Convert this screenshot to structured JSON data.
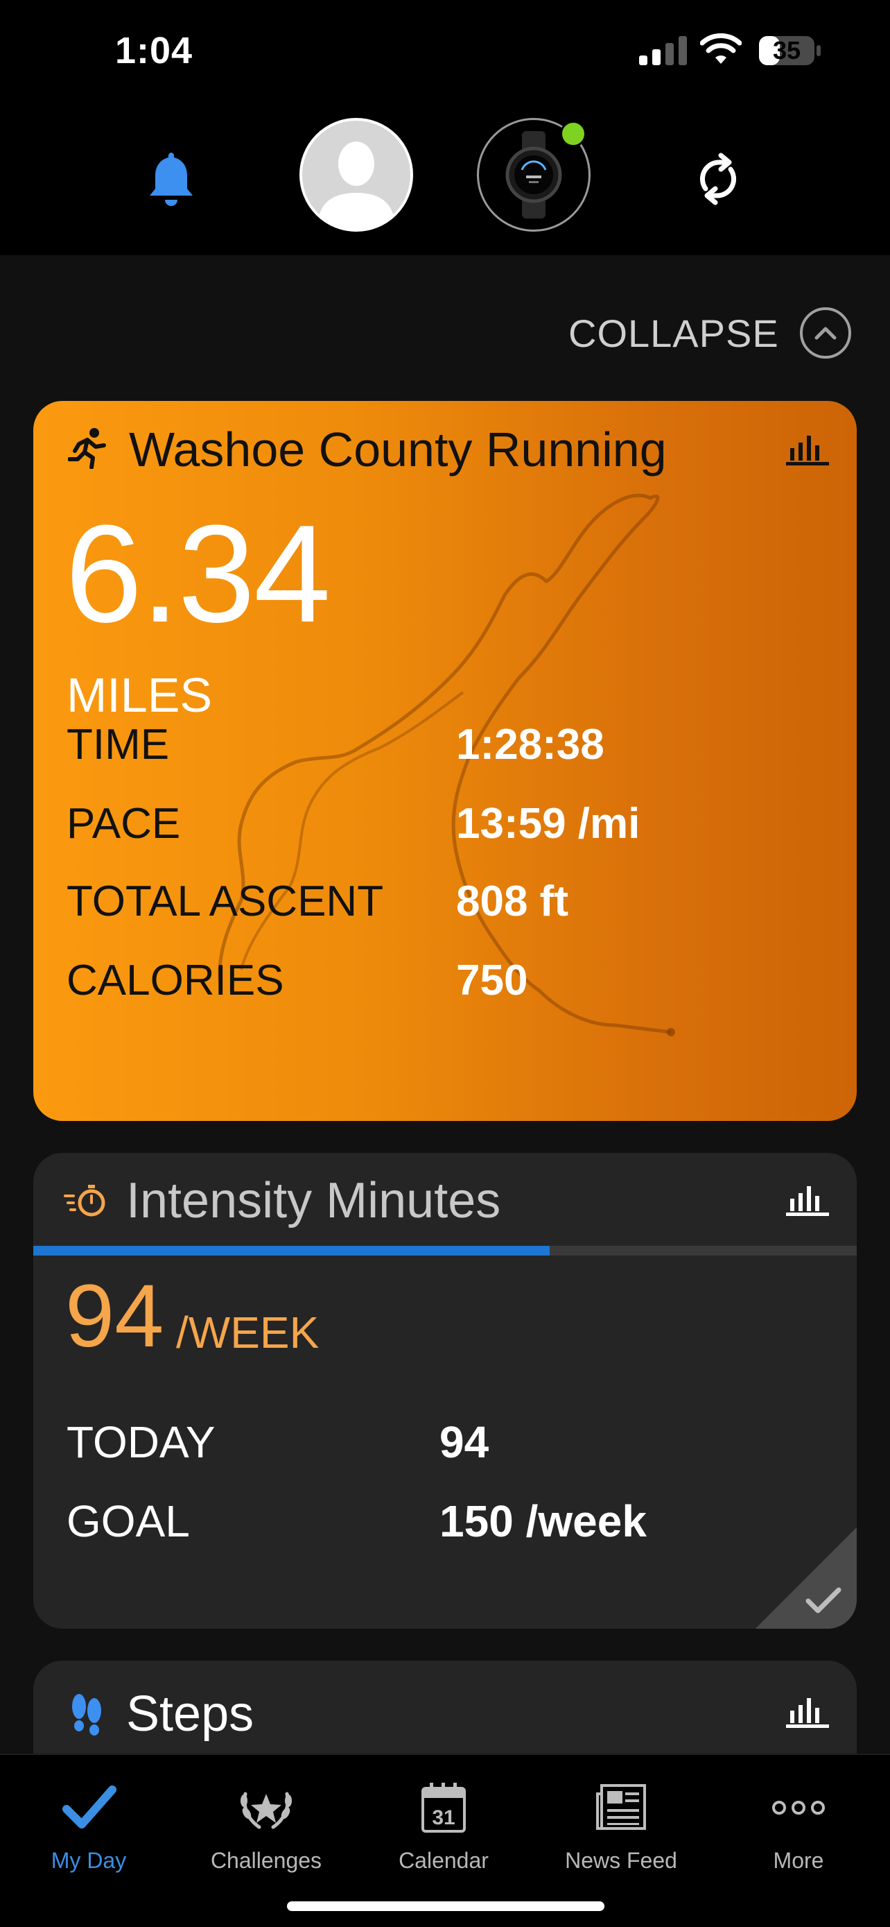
{
  "status_bar": {
    "time": "1:04",
    "battery": "35"
  },
  "header": {
    "icons": [
      "bell-icon",
      "avatar",
      "device-watch",
      "sync-icon"
    ],
    "device_connected_color": "#7ed321"
  },
  "collapse": {
    "label": "COLLAPSE"
  },
  "activity": {
    "title": "Washoe County Running",
    "distance": "6.34",
    "distance_unit": "MILES",
    "stats": [
      {
        "label": "TIME",
        "value": "1:28:38"
      },
      {
        "label": "PACE",
        "value": "13:59 /mi"
      },
      {
        "label": "TOTAL ASCENT",
        "value": "808 ft"
      },
      {
        "label": "CALORIES",
        "value": "750"
      }
    ],
    "accent_color": "#f39200"
  },
  "intensity": {
    "title": "Intensity Minutes",
    "value": "94",
    "unit": "/WEEK",
    "progress": 0.627,
    "rows": [
      {
        "label": "TODAY",
        "value": "94"
      },
      {
        "label": "GOAL",
        "value": "150 /week"
      }
    ],
    "accent_color": "#f5a54a",
    "progress_color": "#1d76d2"
  },
  "steps": {
    "title": "Steps"
  },
  "tabs": [
    {
      "label": "My Day",
      "icon": "check-icon",
      "active": true
    },
    {
      "label": "Challenges",
      "icon": "laurel-icon",
      "active": false
    },
    {
      "label": "Calendar",
      "icon": "calendar-icon",
      "calendar_day": "31",
      "active": false
    },
    {
      "label": "News Feed",
      "icon": "newsfeed-icon",
      "active": false
    },
    {
      "label": "More",
      "icon": "more-icon",
      "active": false
    }
  ]
}
